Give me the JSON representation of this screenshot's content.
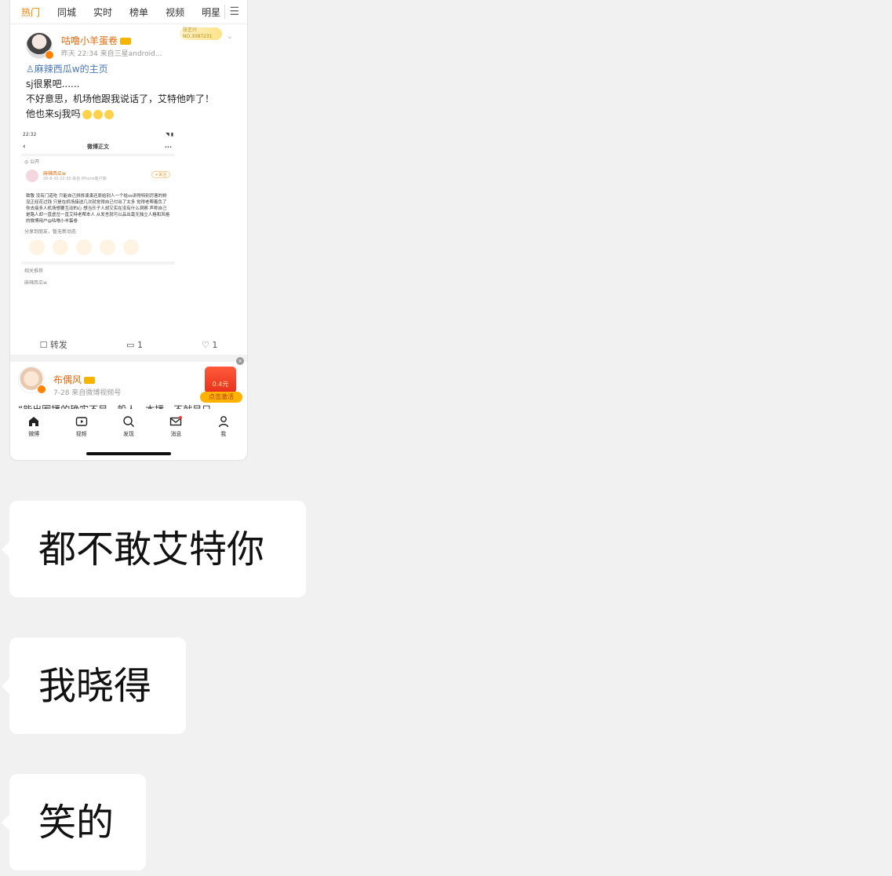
{
  "feed": {
    "tabs": [
      "热门",
      "同城",
      "实时",
      "榜单",
      "视频",
      "明星"
    ],
    "active_tab": "热门",
    "post1": {
      "username": "咕噜小羊蛋卷",
      "meta": "昨天 22:34  来自三星android...",
      "fan_badge": "张艺兴 NO.3087231",
      "link_text": "麻辣西瓜w的主页",
      "lines": [
        "sj很累吧......",
        "不好意思，机场他跟我说话了，艾特他咋了！",
        "他也来sj我吗"
      ],
      "embedded": {
        "time": "22:32",
        "nav_title": "微博正文",
        "visibility": "公开",
        "user": "麻辣西瓜w",
        "user_meta": "26-8-30 22:30  来自 iPhone客户端",
        "follow": "+关注",
        "body": "致敬 没有门道吃 只能自己拼拼凑凑还原给别人一个给ss讲得特别厉害的粉 没正经花过钱 只是在机场接送几次就觉得自己付出了太多 觉得老帮着负了你去接多人机场想要互动的心 想当乐子人却又实在没有什么洞察 声称自己是路人却一直虚岔一直艾特老帮本人 从发言就可以品出毫无独立人格和风格的微博用户@咕噜小羊蛋卷",
        "share_tip": "分享到朋友，暂无新动态",
        "related": "相关推荐",
        "related_user": "麻辣西瓜w"
      },
      "repost": "转发",
      "comments": "1",
      "likes": "1"
    },
    "post2": {
      "username": "布偶风",
      "meta": "7-28  来自微博视频号",
      "text": "“能出圈播的确实不是一般人，本播，不就是只",
      "redpack_amount": "0.4元",
      "redpack_button": "点击激活"
    },
    "bottom_nav": [
      "微博",
      "视频",
      "发现",
      "消息",
      "我"
    ]
  },
  "chat": {
    "messages": [
      "都不敢艾特你",
      "我晓得",
      "笑的"
    ]
  }
}
